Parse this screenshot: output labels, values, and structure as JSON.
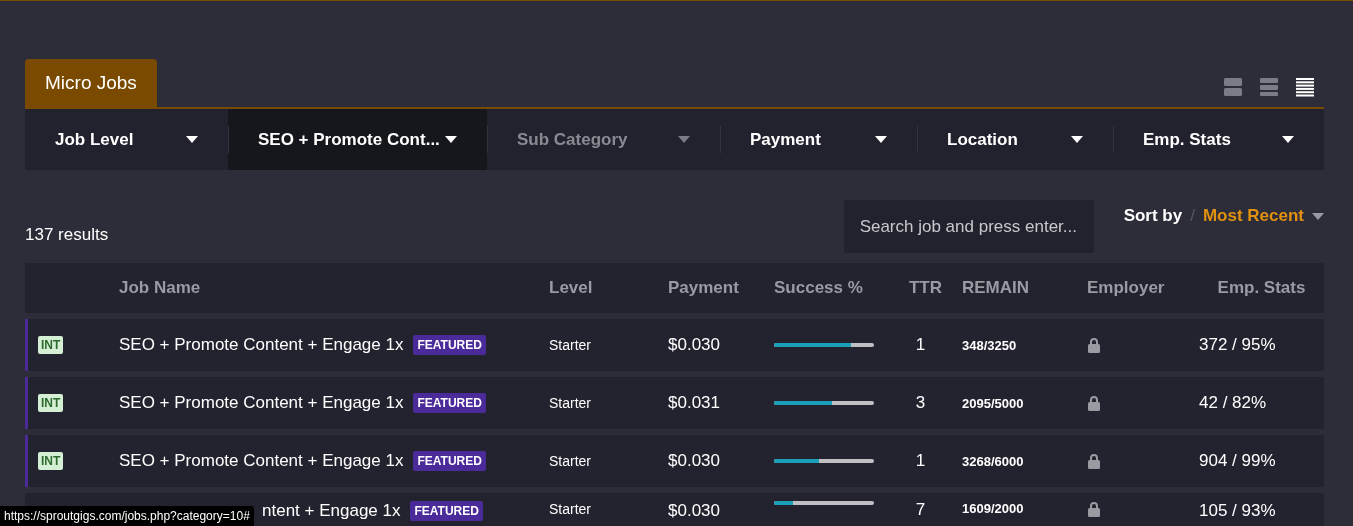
{
  "tab": {
    "label": "Micro Jobs",
    "selected": true
  },
  "views": [
    {
      "kind": "large",
      "selected": false
    },
    {
      "kind": "medium",
      "selected": false
    },
    {
      "kind": "compact",
      "selected": true
    }
  ],
  "filters": [
    {
      "label": "Job Level",
      "active": false,
      "disabled": false
    },
    {
      "label": "SEO + Promote Cont...",
      "active": true,
      "disabled": false
    },
    {
      "label": "Sub Category",
      "active": false,
      "disabled": true
    },
    {
      "label": "Payment",
      "active": false,
      "disabled": false
    },
    {
      "label": "Location",
      "active": false,
      "disabled": false
    },
    {
      "label": "Emp. Stats",
      "active": false,
      "disabled": false
    }
  ],
  "results": "137 results",
  "search": {
    "placeholder": "Search job and press enter..."
  },
  "sort": {
    "label": "Sort by",
    "separator": "/",
    "value": "Most Recent"
  },
  "table": {
    "columns": [
      "Job Name",
      "Level",
      "Payment",
      "Success %",
      "TTR",
      "REMAIN",
      "Employer",
      "Emp. Stats"
    ],
    "rows": [
      {
        "tag": "INT",
        "name": "SEO + Promote Content + Engage 1x",
        "badge": "FEATURED",
        "level_text": "Starter",
        "payment": "$0.030",
        "level": 0.77,
        "ttr": "1",
        "remain": "348/3250",
        "employer_locked": true,
        "emp_stats": "372 / 95%",
        "obscured": false
      },
      {
        "tag": "INT",
        "name": "SEO + Promote Content + Engage 1x",
        "badge": "FEATURED",
        "level_text": "Starter",
        "payment": "$0.031",
        "level": 0.58,
        "ttr": "3",
        "remain": "2095/5000",
        "employer_locked": true,
        "emp_stats": "42 / 82%",
        "obscured": false
      },
      {
        "tag": "INT",
        "name": "SEO + Promote Content + Engage 1x",
        "badge": "FEATURED",
        "level_text": "Starter",
        "payment": "$0.030",
        "level": 0.45,
        "ttr": "1",
        "remain": "3268/6000",
        "employer_locked": true,
        "emp_stats": "904 / 99%",
        "obscured": false
      },
      {
        "name": "ntent + Engage 1x",
        "badge": "FEATURED",
        "level_text": "Starter",
        "payment": "$0.030",
        "level": 0.19,
        "ttr": "7",
        "remain": "1609/2000",
        "employer_locked": true,
        "emp_stats": "105 / 93%",
        "obscured": true
      }
    ]
  },
  "status_url": "https://sproutgigs.com/jobs.php?category=10#"
}
